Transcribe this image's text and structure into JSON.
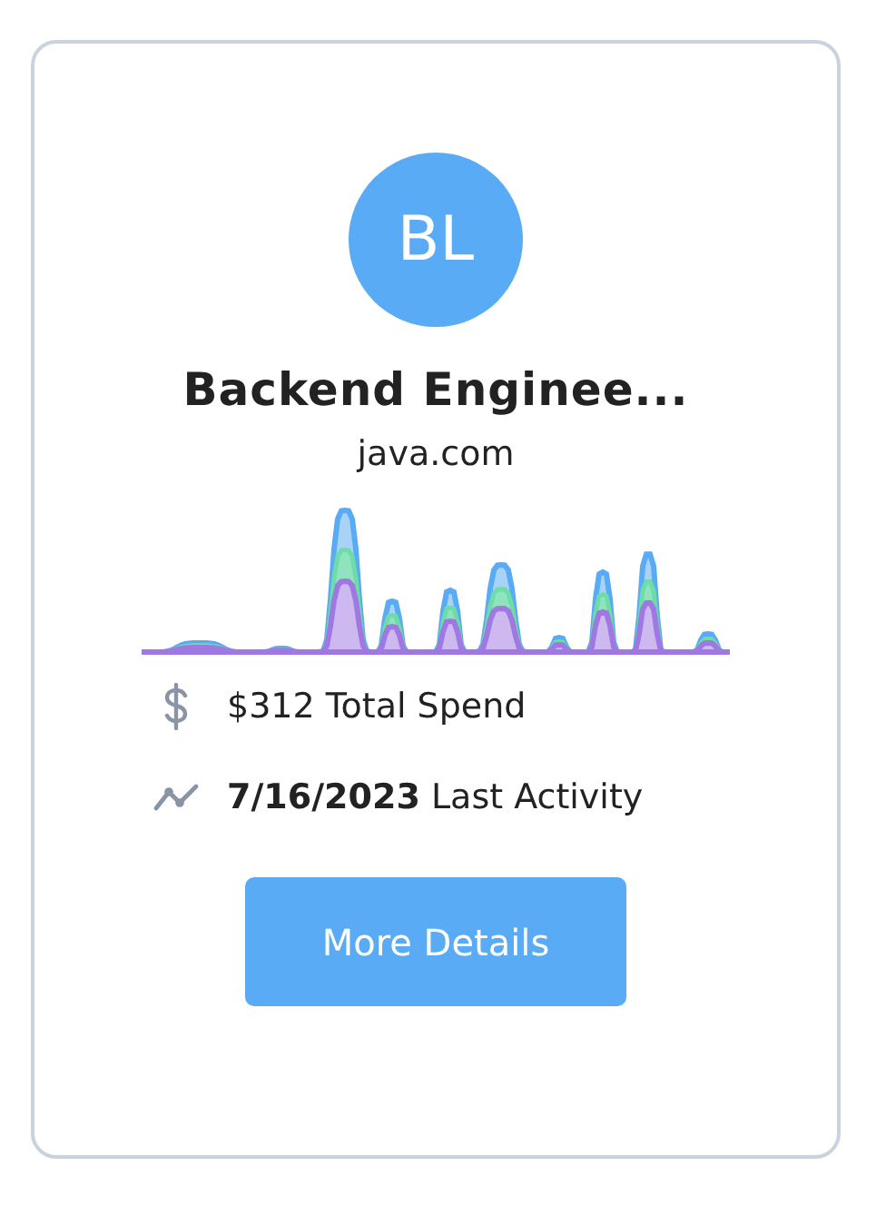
{
  "card": {
    "avatar": {
      "initials": "BL"
    },
    "title": "Backend Enginee...",
    "domain": "java.com",
    "stats": [
      {
        "kind": "spend",
        "text": "$312 Total Spend"
      },
      {
        "kind": "activity",
        "text": "**7/16/2023** Last Activity"
      }
    ],
    "button": {
      "label": "More Details"
    }
  }
}
